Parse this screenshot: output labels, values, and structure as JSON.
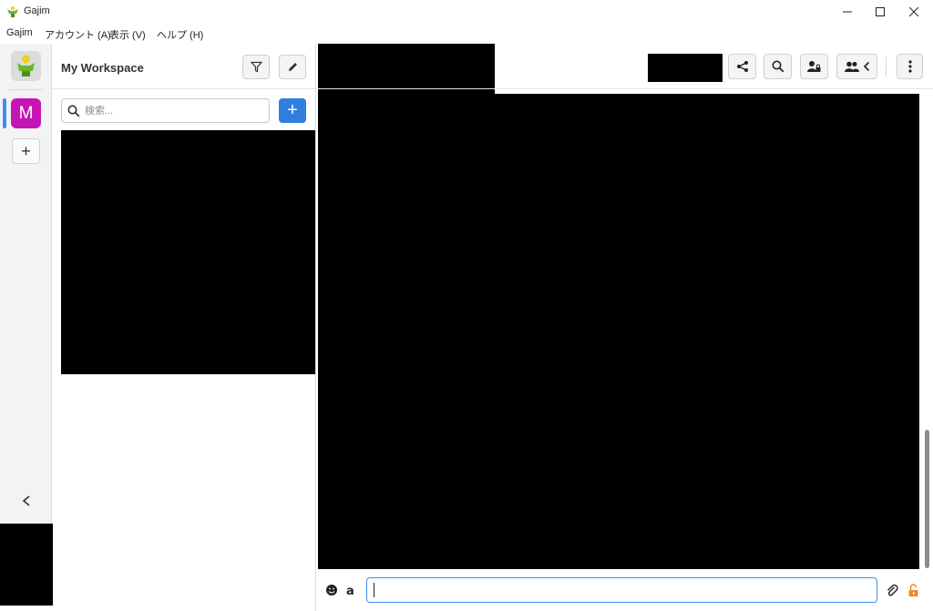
{
  "window": {
    "title": "Gajim"
  },
  "menu": {
    "items": [
      "Gajim",
      "アカウント (A)",
      "表示 (V)",
      "ヘルプ (H)"
    ]
  },
  "workspace_bar": {
    "workspace_letter": "M",
    "add_symbol": "+"
  },
  "sidebar": {
    "title": "My Workspace",
    "search_placeholder": "検索...",
    "add_symbol": "+"
  },
  "colors": {
    "accent": "#2f7ee0",
    "workspace": "#c615b5",
    "focus": "#3d8ef3"
  }
}
